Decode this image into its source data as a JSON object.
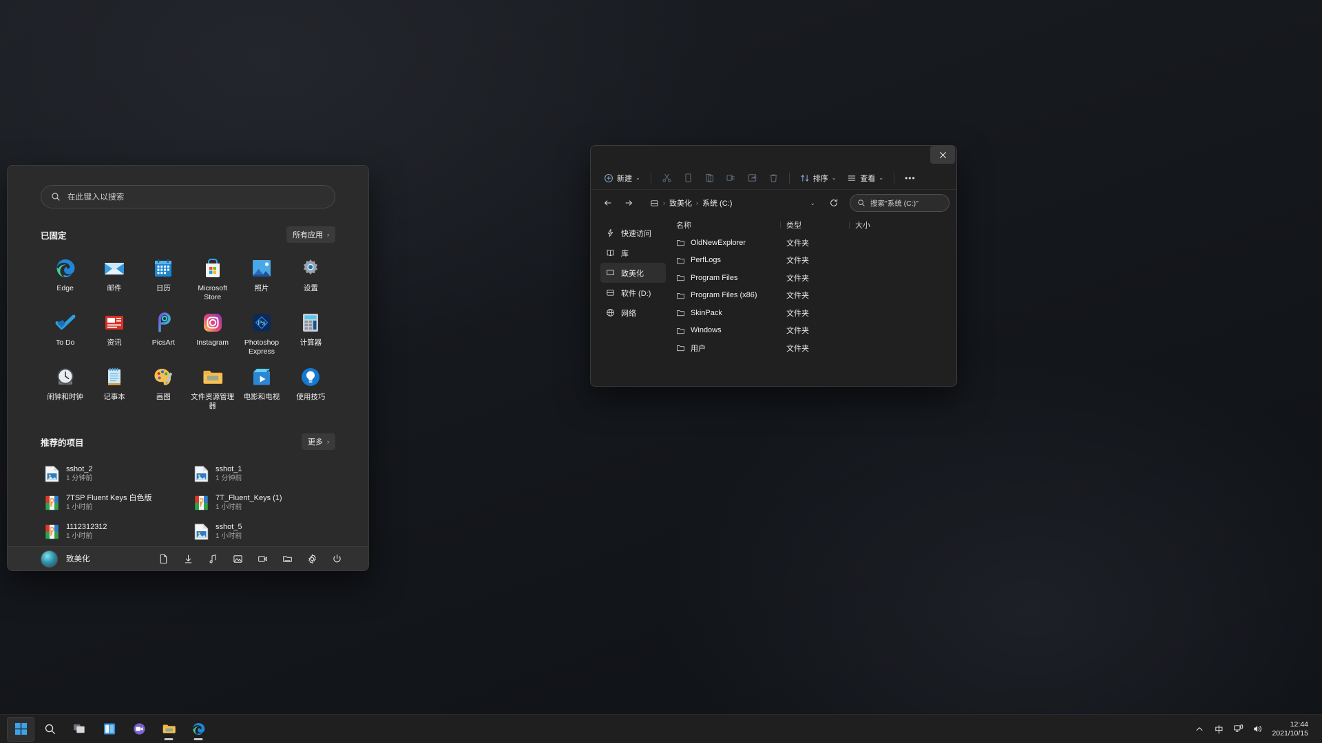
{
  "desktop": {
    "background_color": "#15181d"
  },
  "start_menu": {
    "search": {
      "placeholder": "在此键入以搜索",
      "icon": "search-icon"
    },
    "pinned": {
      "title": "已固定",
      "all_apps_label": "所有应用",
      "all_apps_chevron": "›",
      "apps": [
        {
          "label": "Edge",
          "icon": "edge-icon"
        },
        {
          "label": "邮件",
          "icon": "mail-icon"
        },
        {
          "label": "日历",
          "icon": "calendar-icon"
        },
        {
          "label": "Microsoft Store",
          "icon": "store-icon"
        },
        {
          "label": "照片",
          "icon": "photos-icon"
        },
        {
          "label": "设置",
          "icon": "settings-gear-icon"
        },
        {
          "label": "To Do",
          "icon": "todo-check-icon"
        },
        {
          "label": "资讯",
          "icon": "news-icon"
        },
        {
          "label": "PicsArt",
          "icon": "picsart-icon"
        },
        {
          "label": "Instagram",
          "icon": "instagram-icon"
        },
        {
          "label": "Photoshop Express",
          "icon": "photoshop-express-icon"
        },
        {
          "label": "计算器",
          "icon": "calculator-icon"
        },
        {
          "label": "闹钟和时钟",
          "icon": "alarm-clock-icon"
        },
        {
          "label": "记事本",
          "icon": "notepad-icon"
        },
        {
          "label": "画图",
          "icon": "paint-icon"
        },
        {
          "label": "文件资源管理器",
          "icon": "folder-icon"
        },
        {
          "label": "电影和电视",
          "icon": "movies-tv-icon"
        },
        {
          "label": "使用技巧",
          "icon": "tips-bulb-icon"
        }
      ]
    },
    "recommended": {
      "title": "推荐的项目",
      "more_label": "更多",
      "more_chevron": "›",
      "items": [
        {
          "name": "sshot_2",
          "time": "1 分钟前",
          "icon": "image-file-icon"
        },
        {
          "name": "sshot_1",
          "time": "1 分钟前",
          "icon": "image-file-icon"
        },
        {
          "name": "7TSP Fluent Keys 白色版",
          "time": "1 小时前",
          "icon": "winrar-archive-icon"
        },
        {
          "name": "7T_Fluent_Keys (1)",
          "time": "1 小时前",
          "icon": "winrar-archive-icon"
        },
        {
          "name": "1112312312",
          "time": "1 小时前",
          "icon": "winrar-archive-icon"
        },
        {
          "name": "sshot_5",
          "time": "1 小时前",
          "icon": "image-file-icon"
        }
      ]
    },
    "footer": {
      "user_name": "致美化",
      "avatar": "user-avatar",
      "buttons": [
        {
          "icon": "documents-icon"
        },
        {
          "icon": "downloads-icon"
        },
        {
          "icon": "music-icon"
        },
        {
          "icon": "pictures-icon"
        },
        {
          "icon": "videos-icon"
        },
        {
          "icon": "network-folder-icon"
        },
        {
          "icon": "settings-icon"
        },
        {
          "icon": "power-icon"
        }
      ]
    }
  },
  "explorer": {
    "close_label": "✕",
    "toolbar": {
      "new_label": "新建",
      "new_chevron": "⌄",
      "sort_label": "排序",
      "sort_chevron": "⌄",
      "view_label": "查看",
      "view_chevron": "⌄",
      "more_label": "•••",
      "icons": [
        "cut-icon",
        "copy-icon",
        "paste-icon",
        "rename-icon",
        "share-icon",
        "delete-icon"
      ]
    },
    "address": {
      "back_icon": "arrow-left-icon",
      "forward_icon": "arrow-right-icon",
      "drive_icon": "drive-icon",
      "crumbs": [
        "致美化",
        "系统 (C:)"
      ],
      "separator": "›",
      "dropdown_chevron": "⌄",
      "refresh_icon": "refresh-icon",
      "search_placeholder": "搜索\"系统 (C:)\"",
      "search_icon": "search-icon"
    },
    "nav": {
      "items": [
        {
          "label": "快速访问",
          "icon": "quick-access-icon",
          "selected": false
        },
        {
          "label": "库",
          "icon": "library-icon",
          "selected": false
        },
        {
          "label": "致美化",
          "icon": "this-pc-icon",
          "selected": true
        },
        {
          "label": "软件 (D:)",
          "icon": "drive-icon",
          "selected": false
        },
        {
          "label": "网络",
          "icon": "network-globe-icon",
          "selected": false
        }
      ]
    },
    "columns": [
      "名称",
      "类型",
      "大小"
    ],
    "sort_indicator": "^",
    "files": [
      {
        "name": "OldNewExplorer",
        "type": "文件夹",
        "size": "",
        "icon": "folder-icon"
      },
      {
        "name": "PerfLogs",
        "type": "文件夹",
        "size": "",
        "icon": "folder-icon"
      },
      {
        "name": "Program Files",
        "type": "文件夹",
        "size": "",
        "icon": "folder-icon"
      },
      {
        "name": "Program Files (x86)",
        "type": "文件夹",
        "size": "",
        "icon": "folder-icon"
      },
      {
        "name": "SkinPack",
        "type": "文件夹",
        "size": "",
        "icon": "folder-icon"
      },
      {
        "name": "Windows",
        "type": "文件夹",
        "size": "",
        "icon": "folder-icon"
      },
      {
        "name": "用户",
        "type": "文件夹",
        "size": "",
        "icon": "folder-icon"
      }
    ]
  },
  "taskbar": {
    "items": [
      {
        "name": "start-button",
        "icon": "windows-logo-icon",
        "active": true,
        "running": false
      },
      {
        "name": "search-button",
        "icon": "search-icon",
        "active": false,
        "running": false
      },
      {
        "name": "task-view-button",
        "icon": "task-view-icon",
        "active": false,
        "running": false
      },
      {
        "name": "widgets-button",
        "icon": "widgets-icon",
        "active": false,
        "running": false
      },
      {
        "name": "chat-button",
        "icon": "chat-camera-icon",
        "active": false,
        "running": false
      },
      {
        "name": "file-explorer-button",
        "icon": "folder-icon",
        "active": false,
        "running": true
      },
      {
        "name": "edge-button",
        "icon": "edge-icon",
        "active": false,
        "running": true
      }
    ],
    "tray": {
      "overflow_icon": "chevron-up-icon",
      "ime_label": "中",
      "network_icon": "network-icon",
      "volume_icon": "volume-icon",
      "time": "12:44",
      "date": "2021/10/15"
    }
  }
}
